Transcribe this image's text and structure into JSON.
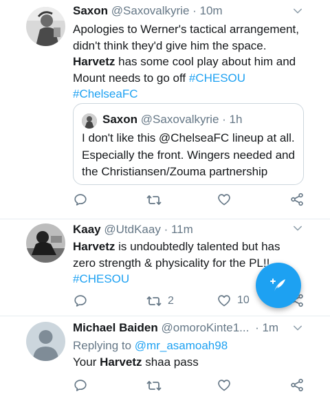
{
  "tweets": [
    {
      "name": "Saxon",
      "handle": "@Saxovalkyrie",
      "time": "· 10m",
      "body": {
        "line1": "Apologies to Werner's tactical arrangement,",
        "line2": "didn't think they'd give him the space.",
        "line3_bold": "Harvetz",
        "line3_rest": " has some cool play about him and",
        "line4_text": "Mount needs to go off ",
        "line4_tag": "#CHESOU",
        "line5_tag": "#ChelseaFC"
      },
      "quote": {
        "name": "Saxon",
        "handle": "@Saxovalkyrie · 1h",
        "line1": "I don't like this @ChelseaFC lineup at all.",
        "line2": "Especially the front. Wingers needed and",
        "line3": "the Christiansen/Zouma partnership"
      },
      "actions": {
        "replies": "",
        "retweets": "",
        "likes": ""
      }
    },
    {
      "name": "Kaay",
      "handle": "@UtdKaay",
      "time": "· 11m",
      "body": {
        "line1_bold": "Harvetz",
        "line1_rest": " is undoubtedly talented but has",
        "line2": "zero strength & physicality for the PL!!",
        "line3_tag": "#CHESOU"
      },
      "actions": {
        "replies": "",
        "retweets": "2",
        "likes": "10"
      }
    },
    {
      "name": "Michael Baiden",
      "handle": "@omoroKinte1...",
      "time": "· 1m",
      "replying_label": "Replying to ",
      "replying_to": "@mr_asamoah98",
      "body": {
        "line1_text": "Your ",
        "line1_bold": "Harvetz",
        "line1_rest": " shaa pass"
      },
      "actions": {
        "replies": "",
        "retweets": "",
        "likes": ""
      }
    }
  ],
  "fab": {
    "icon": "compose-icon"
  },
  "colors": {
    "accent": "#1da1f2",
    "secondary_text": "#657786",
    "primary_text": "#14171a",
    "divider": "#e6ecf0"
  }
}
